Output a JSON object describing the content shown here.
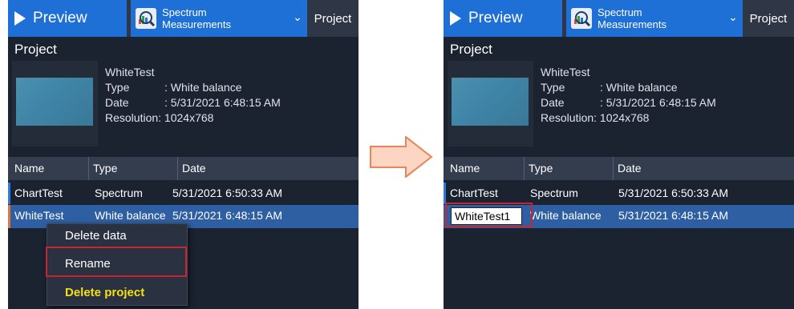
{
  "topbar": {
    "preview_label": "Preview",
    "spectrum_line1": "Spectrum",
    "spectrum_line2": "Measurements",
    "chevron": "⌄",
    "project_label": "Project"
  },
  "panel": {
    "title": "Project",
    "info": {
      "name": "WhiteTest",
      "type_key": "Type",
      "type_val": ": White balance",
      "date_key": "Date",
      "date_val": ": 5/31/2021 6:48:15 AM",
      "res_key": "Resolution",
      "res_val": ": 1024x768"
    },
    "columns": [
      "Name",
      "Type",
      "Date"
    ],
    "rows": [
      {
        "name": "ChartTest",
        "type": "Spectrum",
        "date": "5/31/2021 6:50:33 AM"
      },
      {
        "name": "WhiteTest",
        "type": "White balance",
        "date": "5/31/2021 6:48:15 AM"
      }
    ]
  },
  "context_menu": {
    "items": [
      "Delete data",
      "Rename",
      "Delete project"
    ]
  },
  "rename": {
    "value": "WhiteTest1"
  },
  "colors": {
    "accent_blue": "#1e6fd6",
    "panel_bg": "#1b2230",
    "selected_row": "#2f5fa3",
    "highlight_red": "#c8262e",
    "delete_yellow": "#f4e016",
    "arrow_fill": "#fcd6c2",
    "arrow_stroke": "#e6865a"
  }
}
